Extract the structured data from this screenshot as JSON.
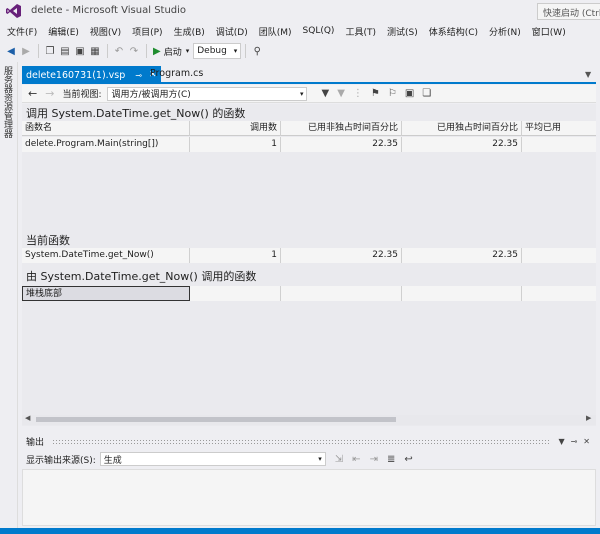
{
  "window": {
    "title": "delete - Microsoft Visual Studio",
    "quick_launch": "快速启动 (Ctrl+Q)"
  },
  "menu": {
    "items": [
      "文件(F)",
      "编辑(E)",
      "视图(V)",
      "项目(P)",
      "生成(B)",
      "调试(D)",
      "团队(M)",
      "SQL(Q)",
      "工具(T)",
      "测试(S)",
      "体系结构(C)",
      "分析(N)",
      "窗口(W)"
    ]
  },
  "toolbar": {
    "start_label": "启动",
    "config": "Debug"
  },
  "left_strip": {
    "label": "服务器资源管理器"
  },
  "tabs": {
    "active": "delete160731(1).vsp",
    "second": "Program.cs"
  },
  "viewbar": {
    "label": "当前视图:",
    "view": "调用方/被调用方(C)"
  },
  "callers": {
    "title": "调用 System.DateTime.get_Now() 的函数",
    "columns": {
      "name": "函数名",
      "calls": "调用数",
      "inclusive": "已用非独占时间百分比",
      "exclusive": "已用独占时间百分比",
      "avg": "平均已用"
    },
    "rows": [
      {
        "name": "delete.Program.Main(string[])",
        "calls": "1",
        "inclusive": "22.35",
        "exclusive": "22.35"
      }
    ]
  },
  "current": {
    "title": "当前函数",
    "row": {
      "name": "System.DateTime.get_Now()",
      "calls": "1",
      "inclusive": "22.35",
      "exclusive": "22.35"
    }
  },
  "callees": {
    "title": "由 System.DateTime.get_Now() 调用的函数",
    "rows": [
      {
        "name": "堆栈底部"
      }
    ]
  },
  "output": {
    "title": "输出",
    "source_label": "显示输出来源(S):",
    "source_value": "生成"
  }
}
